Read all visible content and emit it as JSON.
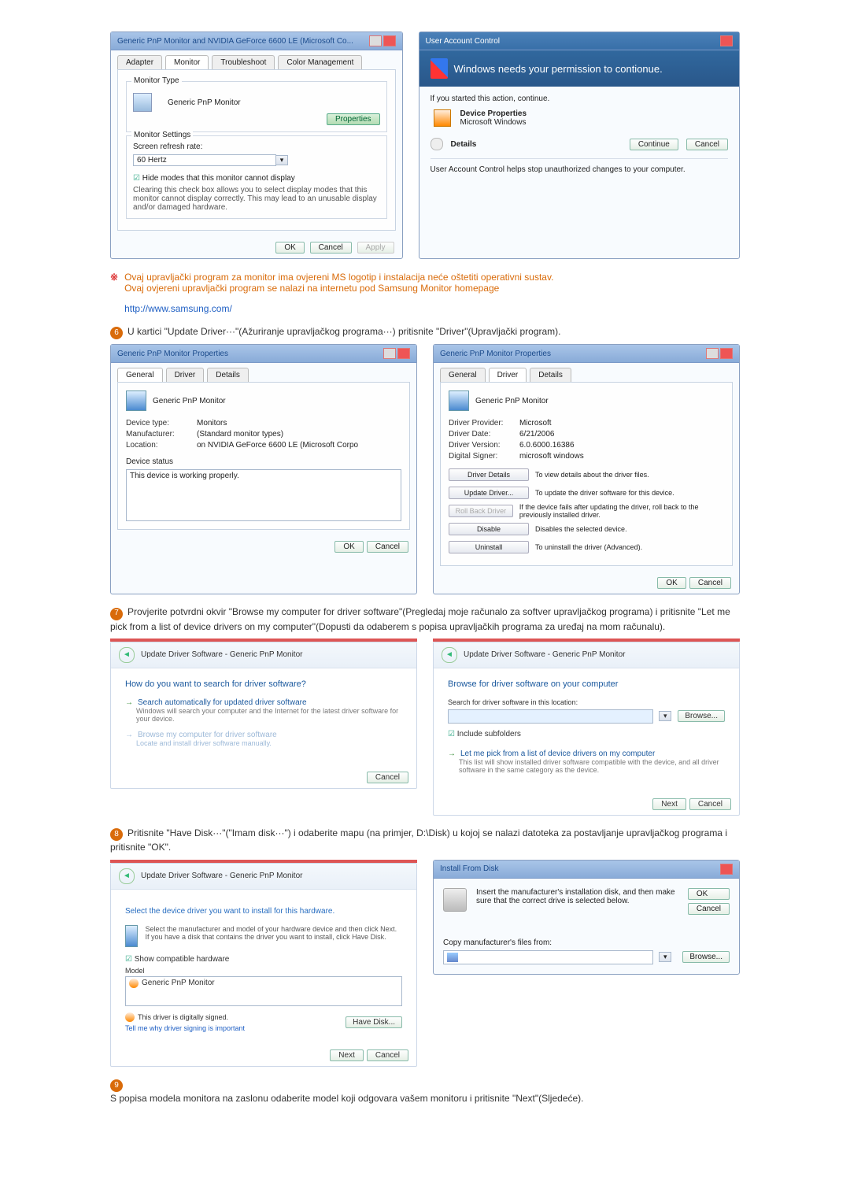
{
  "dlg1": {
    "title": "Generic PnP Monitor and NVIDIA GeForce 6600 LE (Microsoft Co...",
    "tabs": [
      "Adapter",
      "Monitor",
      "Troubleshoot",
      "Color Management"
    ],
    "group1": "Monitor Type",
    "mon_type": "Generic PnP Monitor",
    "btn_props": "Properties",
    "group2": "Monitor Settings",
    "refresh_label": "Screen refresh rate:",
    "refresh_val": "60 Hertz",
    "hide_label": "Hide modes that this monitor cannot display",
    "hide_desc": "Clearing this check box allows you to select display modes that this monitor cannot display correctly. This may lead to an unusable display and/or damaged hardware.",
    "ok": "OK",
    "cancel": "Cancel",
    "apply": "Apply"
  },
  "uac": {
    "title": "User Account Control",
    "msg": "Windows needs your permission to contionue.",
    "started": "If you started this action, continue.",
    "devprop": "Device Properties",
    "mswin": "Microsoft Windows",
    "details": "Details",
    "continue": "Continue",
    "cancel": "Cancel",
    "foot": "User Account Control helps stop unauthorized changes to your computer."
  },
  "note": {
    "l1": "Ovaj upravljački program za monitor ima ovjereni MS logotip i instalacija neće oštetiti operativni sustav.",
    "l2": "Ovaj ovjereni upravljački program se nalazi na internetu pod Samsung Monitor homepage",
    "url": "http://www.samsung.com/"
  },
  "step6": "U kartici \"Update Driver···\"(Ažuriranje upravljačkog programa···) pritisnite \"Driver\"(Upravljački program).",
  "dlg2": {
    "title": "Generic PnP Monitor Properties",
    "tabs": [
      "General",
      "Driver",
      "Details"
    ],
    "head": "Generic PnP Monitor",
    "devtype_k": "Device type:",
    "devtype_v": "Monitors",
    "manu_k": "Manufacturer:",
    "manu_v": "(Standard monitor types)",
    "loc_k": "Location:",
    "loc_v": "on NVIDIA GeForce 6600 LE (Microsoft Corpo",
    "status_h": "Device status",
    "status_v": "This device is working properly.",
    "ok": "OK",
    "cancel": "Cancel"
  },
  "dlg3": {
    "title": "Generic PnP Monitor Properties",
    "tabs": [
      "General",
      "Driver",
      "Details"
    ],
    "head": "Generic PnP Monitor",
    "kv": {
      "prov_k": "Driver Provider:",
      "prov_v": "Microsoft",
      "date_k": "Driver Date:",
      "date_v": "6/21/2006",
      "ver_k": "Driver Version:",
      "ver_v": "6.0.6000.16386",
      "sign_k": "Digital Signer:",
      "sign_v": "microsoft windows"
    },
    "b1": "Driver Details",
    "d1": "To view details about the driver files.",
    "b2": "Update Driver...",
    "d2": "To update the driver software for this device.",
    "b3": "Roll Back Driver",
    "d3": "If the device fails after updating the driver, roll back to the previously installed driver.",
    "b4": "Disable",
    "d4": "Disables the selected device.",
    "b5": "Uninstall",
    "d5": "To uninstall the driver (Advanced).",
    "ok": "OK",
    "cancel": "Cancel"
  },
  "step7": "Provjerite potvrdni okvir \"Browse my computer for driver software\"(Pregledaj moje računalo za softver upravljačkog programa) i pritisnite \"Let me pick from a list of device drivers on my computer\"(Dopusti da odaberem s popisa upravljačkih programa za uređaj na mom računalu).",
  "wizA": {
    "title": "Update Driver Software - Generic PnP Monitor",
    "q": "How do you want to search for driver software?",
    "o1": "Search automatically for updated driver software",
    "o1d": "Windows will search your computer and the Internet for the latest driver software for your device.",
    "o2": "Browse my computer for driver software",
    "o2d": "Locate and install driver software manually.",
    "cancel": "Cancel"
  },
  "wizB": {
    "title": "Update Driver Software - Generic PnP Monitor",
    "q": "Browse for driver software on your computer",
    "srch": "Search for driver software in this location:",
    "browse": "Browse...",
    "incl": "Include subfolders",
    "o1": "Let me pick from a list of device drivers on my computer",
    "o1d": "This list will show installed driver software compatible with the device, and all driver software in the same category as the device.",
    "next": "Next",
    "cancel": "Cancel"
  },
  "step8": "Pritisnite \"Have Disk···\"(\"Imam disk···\") i odaberite mapu (na primjer, D:\\Disk) u kojoj se nalazi datoteka za postavljanje upravljačkog programa i pritisnite \"OK\".",
  "wizC": {
    "title": "Update Driver Software - Generic PnP Monitor",
    "q": "Select the device driver you want to install for this hardware.",
    "hint": "Select the manufacturer and model of your hardware device and then click Next. If you have a disk that contains the driver you want to install, click Have Disk.",
    "compat": "Show compatible hardware",
    "model_h": "Model",
    "model_v": "Generic PnP Monitor",
    "signed": "This driver is digitally signed.",
    "tell": "Tell me why driver signing is important",
    "have": "Have Disk...",
    "next": "Next",
    "cancel": "Cancel"
  },
  "dlgD": {
    "title": "Install From Disk",
    "msg": "Insert the manufacturer's installation disk, and then make sure that the correct drive is selected below.",
    "ok": "OK",
    "cancel": "Cancel",
    "copy": "Copy manufacturer's files from:",
    "browse": "Browse..."
  },
  "step9": "S popisa modela monitora na zaslonu odaberite model koji odgovara vašem monitoru i pritisnite \"Next\"(Sljedeće)."
}
